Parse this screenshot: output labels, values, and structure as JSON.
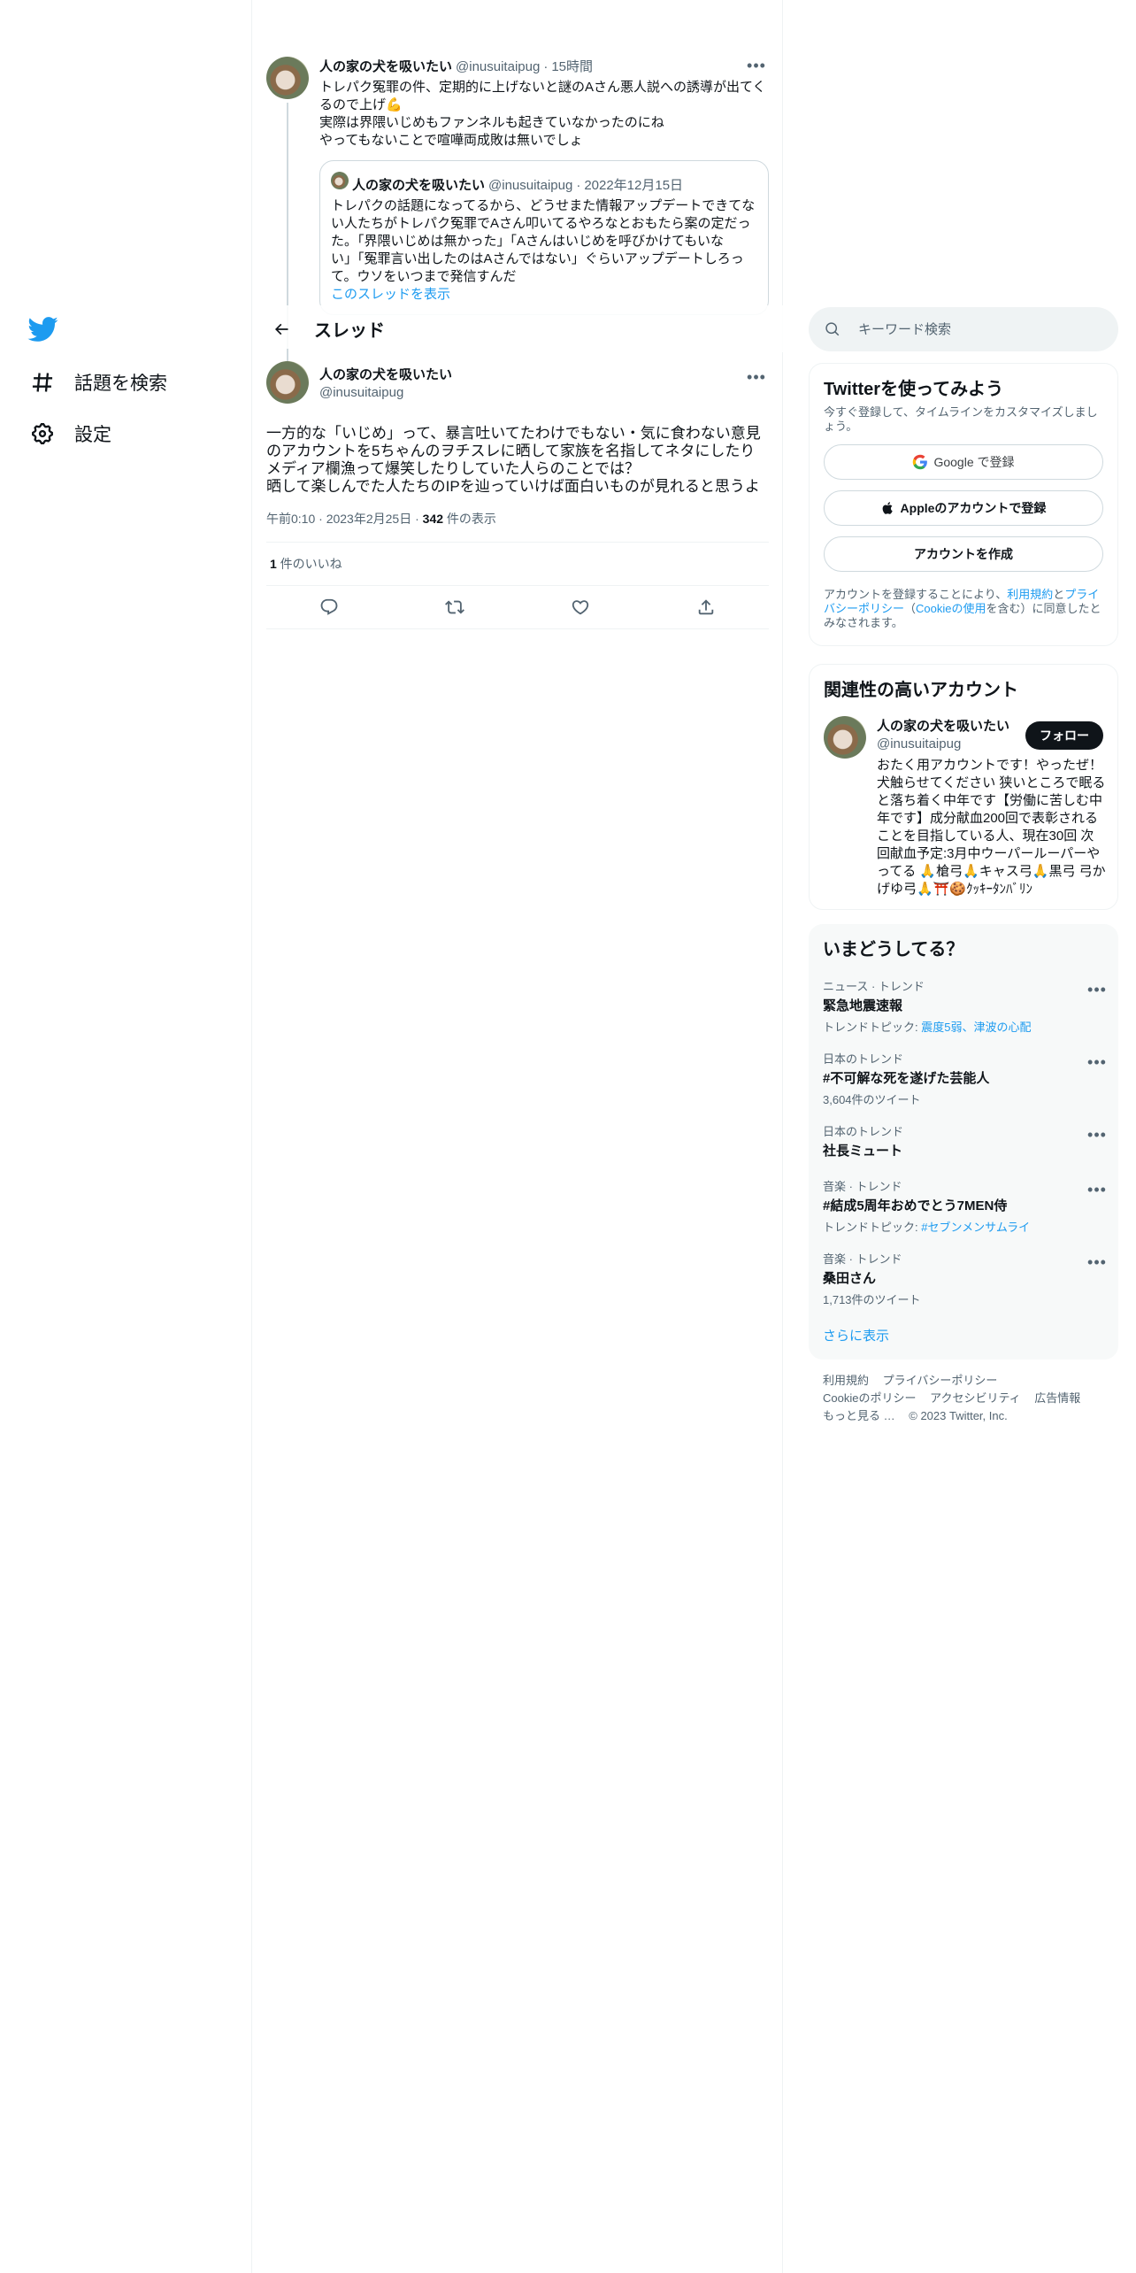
{
  "nav": {
    "explore": "話題を検索",
    "settings": "設定"
  },
  "prev_tweet": {
    "name": "人の家の犬を吸いたい",
    "handle": "@inusuitaipug",
    "dot": "·",
    "time": "15時間",
    "lines": [
      "トレパク冤罪の件、定期的に上げないと謎のAさん悪人説への誘導が出てく",
      "るので上げ💪",
      "実際は界隈いじめもファンネルも起きていなかったのにね",
      "やってもないことで喧嘩両成敗は無いでしょ"
    ],
    "quote": {
      "name": "人の家の犬を吸いたい",
      "handle": "@inusuitaipug",
      "dot": "·",
      "date": "2022年12月15日",
      "lines": [
        "トレパクの話題になってるから、どうせまた情報アップデートできてな",
        "い人たちがトレパク冤罪でAさん叩いてるやろなとおもたら案の定だっ",
        "た。「界隈いじめは無かった」「Aさんはいじめを呼びかけてもいな",
        "い」「冤罪言い出したのはAさんではない」ぐらいアップデートしろっ",
        "て。ウソをいつまで発信すんだ"
      ],
      "show_thread": "このスレッドを表示"
    }
  },
  "header": {
    "title": "スレッド"
  },
  "tweet": {
    "name": "人の家の犬を吸いたい",
    "handle": "@inusuitaipug",
    "lines": [
      "一方的な「いじめ」って、暴言吐いてたわけでもない・気に食わない意見",
      "のアカウントを5ちゃんのヲチスレに晒して家族を名指してネタにしたり",
      "メディア欄漁って爆笑したりしていた人らのことでは？",
      "晒して楽しんでた人たちのIPを辿っていけば面白いものが見れると思うよ"
    ],
    "time": "午前0:10",
    "date": "2023年2月25日",
    "views_count": "342",
    "views_label": " 件の表示",
    "likes_count": "1",
    "likes_label": " 件のいいね"
  },
  "search": {
    "placeholder": "キーワード検索"
  },
  "signup": {
    "title": "Twitterを使ってみよう",
    "desc": "今すぐ登録して、タイムラインをカスタマイズしましょう。",
    "google": "Google で登録",
    "apple": "Appleのアカウントで登録",
    "create": "アカウントを作成",
    "legal_1": "アカウントを登録することにより、",
    "terms": "利用規約",
    "and": "と",
    "privacy": "プライバシーポリシー",
    "paren_open": "（",
    "cookie": "Cookieの使用",
    "legal_2": "を含む）に同意したとみなされます。"
  },
  "related": {
    "title": "関連性の高いアカウント",
    "name": "人の家の犬を吸いたい",
    "handle": "@inusuitaipug",
    "follow": "フォロー",
    "bio": "おたく用アカウントです！やったぜ！犬触らせてください 狭いところで眠ると落ち着く中年です【労働に苦しむ中年です】成分献血200回で表彰されることを目指している人、現在30回 次回献血予定:3月中ウーパールーパーやってる 🙏槍弓🙏キャス弓🙏黒弓 弓かげゆ弓🙏⛩️🍪ｸｯｷｰﾀﾝﾊﾞﾘﾝ"
  },
  "trends": {
    "title": "いまどうしてる？",
    "items": [
      {
        "ctx": "ニュース · トレンド",
        "title": "緊急地震速報",
        "sub_prefix": "トレンドトピック: ",
        "sub_link": "震度5弱、津波の心配"
      },
      {
        "ctx": "日本のトレンド",
        "title": "#不可解な死を遂げた芸能人",
        "sub": "3,604件のツイート"
      },
      {
        "ctx": "日本のトレンド",
        "title": "社長ミュート"
      },
      {
        "ctx": "音楽 · トレンド",
        "title": "#結成5周年おめでとう7MEN侍",
        "sub_prefix": "トレンドトピック: ",
        "sub_link": "#セブンメンサムライ"
      },
      {
        "ctx": "音楽 · トレンド",
        "title": "桑田さん",
        "sub": "1,713件のツイート"
      }
    ],
    "show_more": "さらに表示"
  },
  "footer": {
    "terms": "利用規約",
    "privacy": "プライバシーポリシー",
    "cookie": "Cookieのポリシー",
    "accessibility": "アクセシビリティ",
    "ads": "広告情報",
    "more": "もっと見る …",
    "copyright": "© 2023 Twitter, Inc."
  },
  "colors": {
    "accent": "#1d9bf0",
    "text": "#0f1419",
    "secondary": "#536471",
    "border": "#eff3f4"
  }
}
